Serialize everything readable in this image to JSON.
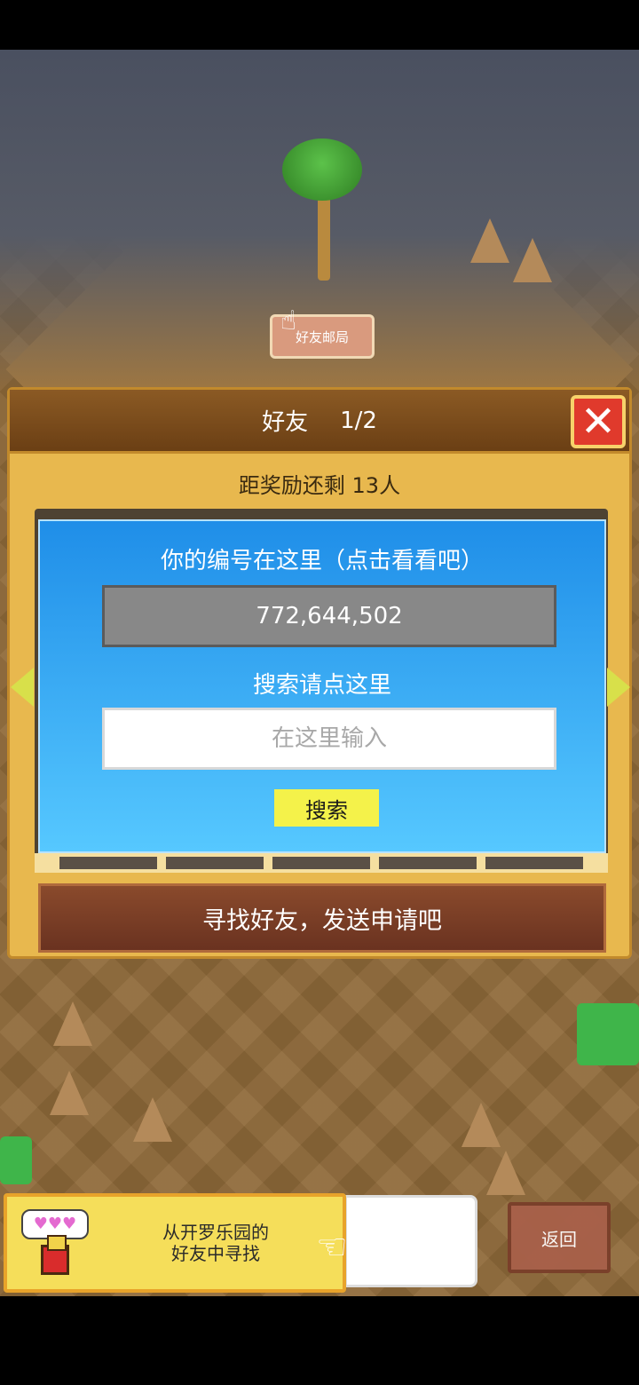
{
  "dialog": {
    "title": "好友",
    "page": "1/2",
    "close_glyph": "✕",
    "reward_text": "距奖励还剩 13人",
    "id_label": "你的编号在这里（点击看看吧）",
    "id_value": "772,644,502",
    "search_label": "搜索请点这里",
    "search_placeholder": "在这里输入",
    "search_button": "搜索",
    "find_button": "寻找好友，发送申请吧"
  },
  "scene": {
    "sign_label": "好友邮局"
  },
  "bottom": {
    "hearts": "♥♥♥",
    "card_text_line1": "从开罗乐园的",
    "card_text_line2": "好友中寻找",
    "back_button": "返回"
  },
  "colors": {
    "dialog_bg": "#e8b84e",
    "header_bg": "#6b3f14",
    "close_red": "#e03a2c",
    "panel_blue_top": "#1f8ee8",
    "panel_blue_bottom": "#56c8ff",
    "search_yellow": "#f4f24a",
    "find_button_brown": "#7a3e24"
  },
  "icons": {
    "close": "close-icon",
    "left_arrow": "chevron-left-icon",
    "right_arrow": "chevron-right-icon",
    "pointer": "hand-pointer-icon"
  }
}
